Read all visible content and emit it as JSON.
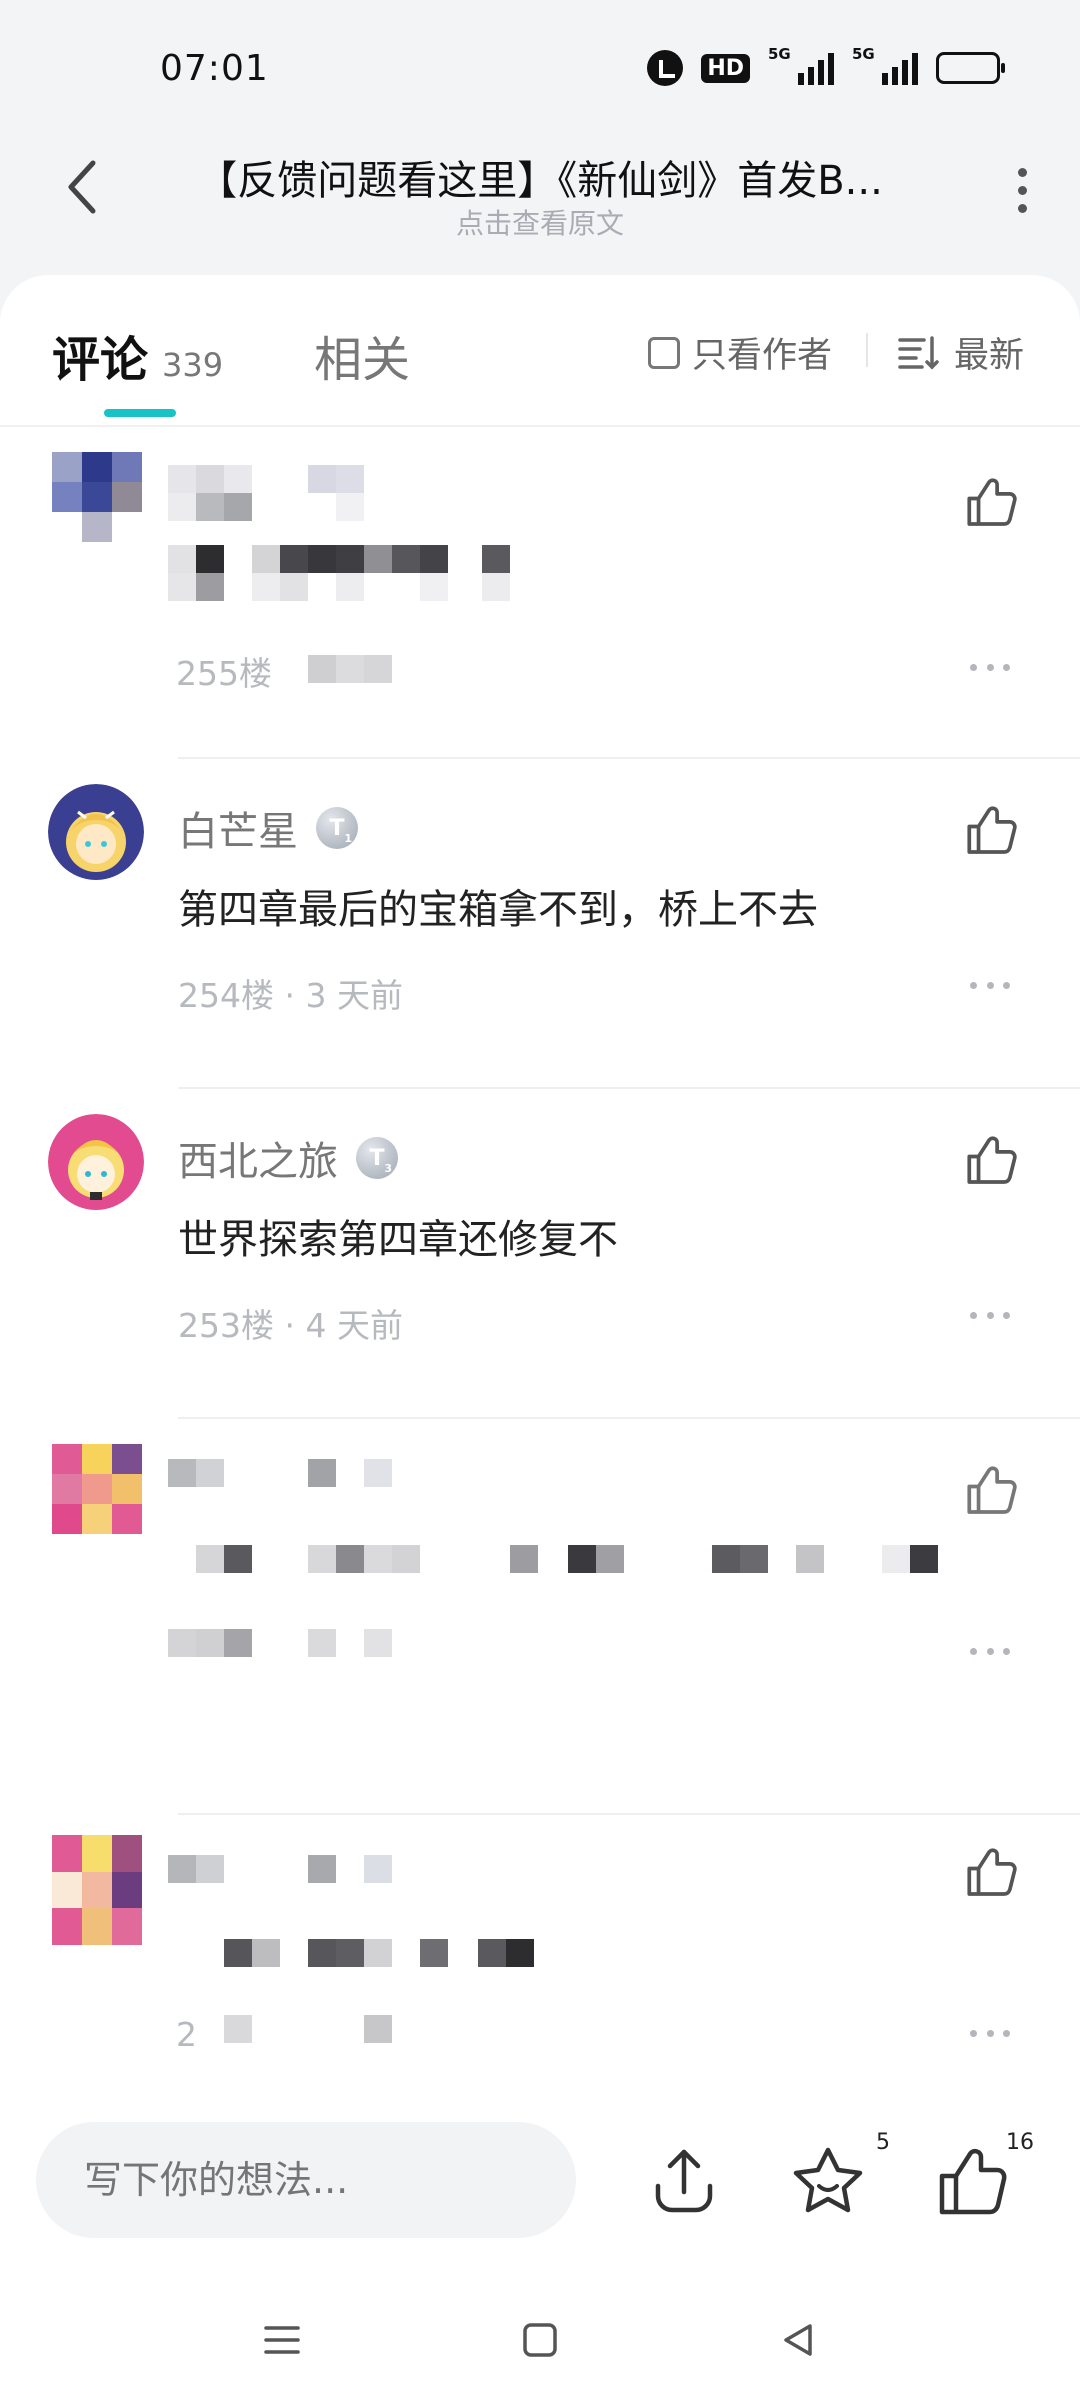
{
  "status_bar": {
    "time": "07:01",
    "network_1": "5G",
    "network_2": "5G",
    "hd": "HD"
  },
  "header": {
    "title": "【反馈问题看这里】《新仙剑》首发B...",
    "subtitle": "点击查看原文"
  },
  "tabs": {
    "comments_label": "评论",
    "comments_count": "339",
    "related_label": "相关",
    "author_only_label": "只看作者",
    "sort_label": "最新"
  },
  "comments": [
    {
      "floor_meta": "255楼"
    },
    {
      "username": "白芒星",
      "level": "T",
      "level_sub": "1",
      "text": "第四章最后的宝箱拿不到，桥上不去",
      "meta": "254楼 · 3 天前"
    },
    {
      "username": "西北之旅",
      "level": "T",
      "level_sub": "3",
      "text": "世界探索第四章还修复不",
      "meta": "253楼 · 4 天前"
    },
    {
      "floor_meta": ""
    },
    {
      "floor_meta": "2"
    }
  ],
  "bottom_bar": {
    "input_placeholder": "写下你的想法...",
    "star_count": "5",
    "like_count": "16"
  },
  "colors": {
    "accent": "#18c3c7",
    "muted_text": "#b6b9be"
  }
}
